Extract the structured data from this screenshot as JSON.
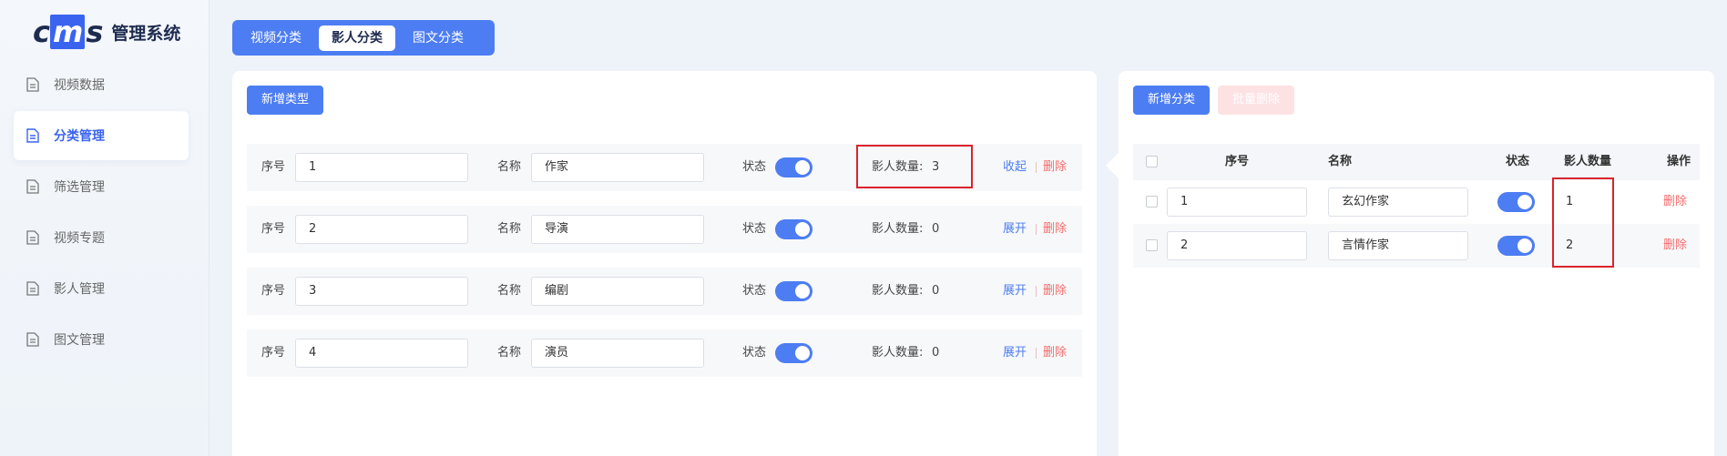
{
  "app": {
    "logo_mark_left": "c",
    "logo_mark_mid": "m",
    "logo_mark_right": "s",
    "title": "管理系统"
  },
  "sidebar": {
    "items": [
      {
        "label": "视频数据",
        "active": false
      },
      {
        "label": "分类管理",
        "active": true
      },
      {
        "label": "筛选管理",
        "active": false
      },
      {
        "label": "视频专题",
        "active": false
      },
      {
        "label": "影人管理",
        "active": false
      },
      {
        "label": "图文管理",
        "active": false
      }
    ]
  },
  "tabs": [
    {
      "label": "视频分类",
      "active": false
    },
    {
      "label": "影人分类",
      "active": true
    },
    {
      "label": "图文分类",
      "active": false
    }
  ],
  "left_panel": {
    "add_button": "新增类型",
    "labels": {
      "index": "序号",
      "name": "名称",
      "status": "状态",
      "count": "影人数量:",
      "delete": "删除"
    },
    "rows": [
      {
        "index": "1",
        "name": "作家",
        "status_on": true,
        "count": "3",
        "action": "收起"
      },
      {
        "index": "2",
        "name": "导演",
        "status_on": true,
        "count": "0",
        "action": "展开"
      },
      {
        "index": "3",
        "name": "编剧",
        "status_on": true,
        "count": "0",
        "action": "展开"
      },
      {
        "index": "4",
        "name": "演员",
        "status_on": true,
        "count": "0",
        "action": "展开"
      }
    ]
  },
  "right_panel": {
    "add_button": "新增分类",
    "batch_delete_button": "批量删除",
    "columns": {
      "index": "序号",
      "name": "名称",
      "status": "状态",
      "count": "影人数量",
      "action": "操作"
    },
    "rows": [
      {
        "index": "1",
        "name": "玄幻作家",
        "status_on": true,
        "count": "1",
        "action": "删除"
      },
      {
        "index": "2",
        "name": "言情作家",
        "status_on": true,
        "count": "2",
        "action": "删除"
      }
    ]
  },
  "colors": {
    "accent": "#4d7df2",
    "danger": "#f56c6c",
    "highlight": "#d9232d"
  }
}
